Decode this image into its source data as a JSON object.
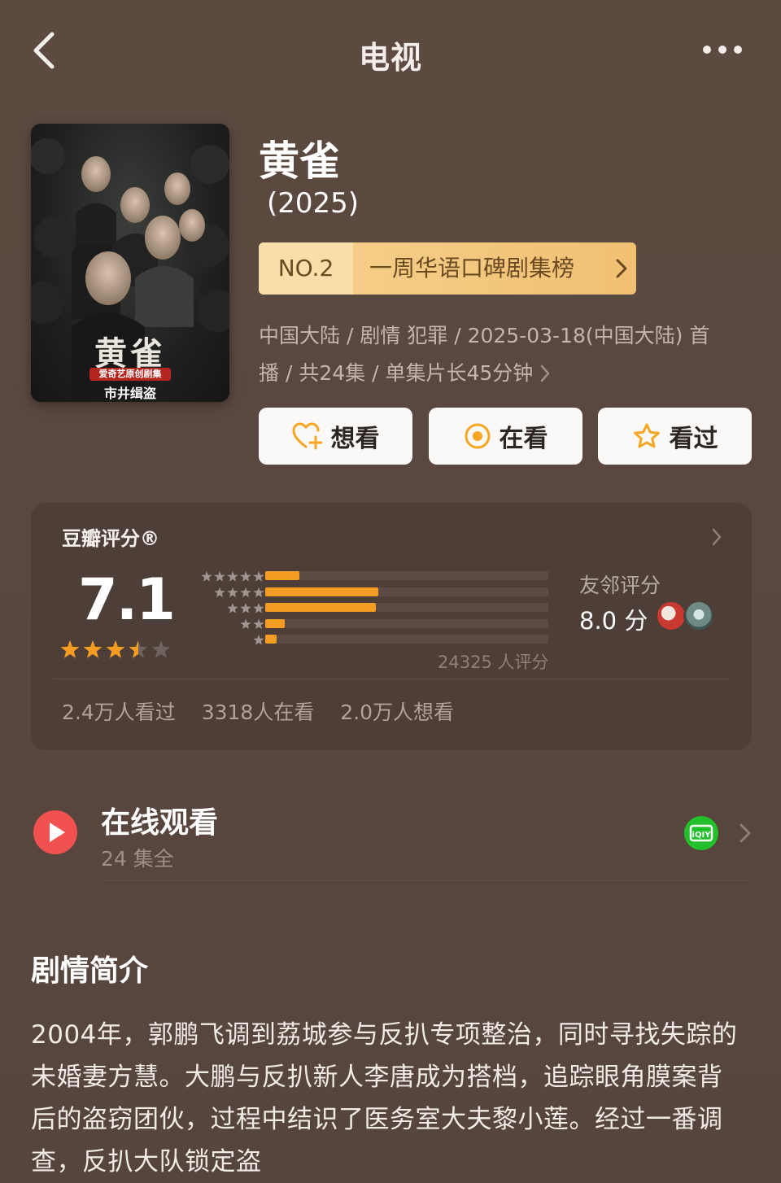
{
  "header": {
    "title": "电视"
  },
  "poster": {
    "title": "黄雀",
    "badge": "爱奇艺原创剧集",
    "caption": "市井缉盗"
  },
  "show": {
    "title": "黄雀",
    "year": "(2025)",
    "rank": {
      "no": "NO.2",
      "label": "一周华语口碑剧集榜"
    },
    "meta_line1": "中国大陆 / 剧情 犯罪 / 2025-03-18(中国大陆) 首",
    "meta_line2": "播 / 共24集 / 单集片长45分钟"
  },
  "actions": [
    {
      "label": "想看",
      "icon": "heart-plus-icon"
    },
    {
      "label": "在看",
      "icon": "target-icon"
    },
    {
      "label": "看过",
      "icon": "star-outline-icon"
    }
  ],
  "rating": {
    "heading": "豆瓣评分®",
    "score": "7.1",
    "stars": 3.5,
    "distribution": [
      {
        "stars": 5,
        "fraction": 0.12
      },
      {
        "stars": 4,
        "fraction": 0.4
      },
      {
        "stars": 3,
        "fraction": 0.39
      },
      {
        "stars": 2,
        "fraction": 0.07
      },
      {
        "stars": 1,
        "fraction": 0.04
      }
    ],
    "count": "24325 人评分",
    "friend_label": "友邻评分",
    "friend_score": "8.0 分",
    "stats": [
      "2.4万人看过",
      "3318人在看",
      "2.0万人想看"
    ]
  },
  "watch": {
    "title": "在线观看",
    "subtitle": "24 集全",
    "provider_icon": "iqiyi-icon"
  },
  "synopsis": {
    "title": "剧情简介",
    "text": "2004年，郭鹏飞调到荔城参与反扒专项整治，同时寻找失踪的未婚妻方慧。大鹏与反扒新人李唐成为搭档，追踪眼角膜案背后的盗窃团伙，过程中结识了医务室大夫黎小莲。经过一番调查，反扒大队锁定盗"
  },
  "colors": {
    "accent": "#f59c22",
    "background": "#5a4940",
    "card": "#4d3e37",
    "rank_gold": "#f1c073"
  }
}
